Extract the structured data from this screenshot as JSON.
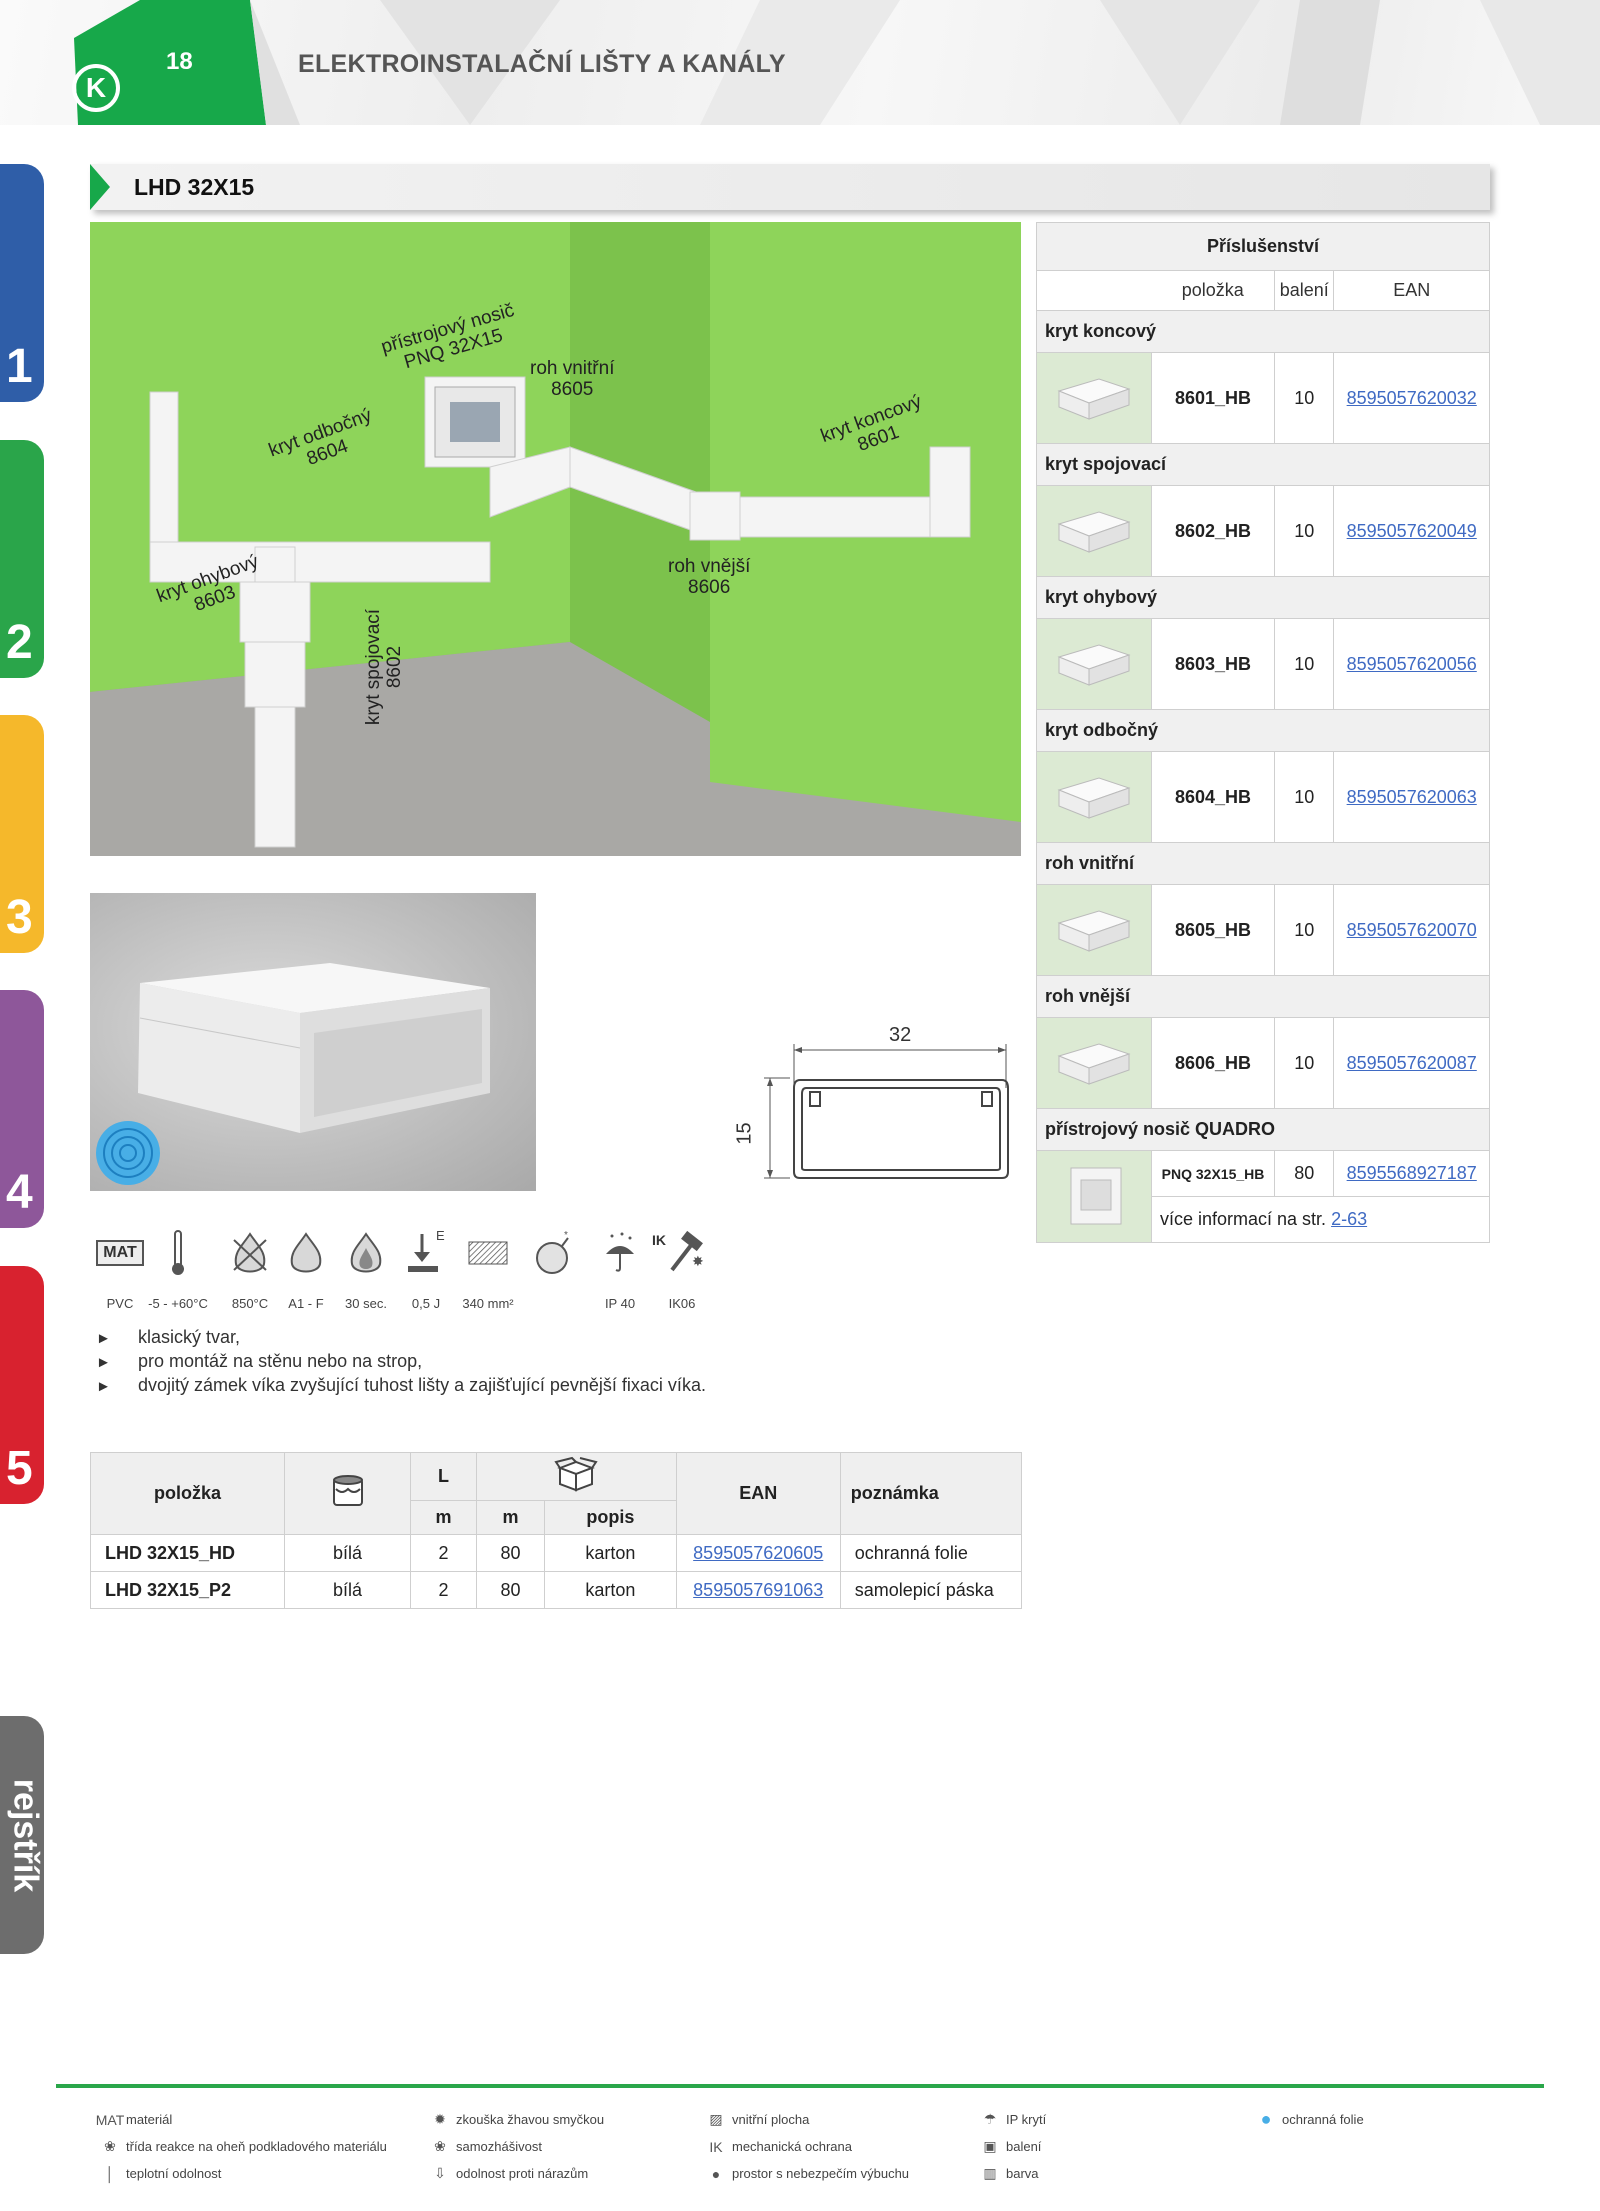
{
  "header": {
    "page_number": "18",
    "logo_letter": "K",
    "section_title": "ELEKTROINSTALAČNÍ LIŠTY A KANÁLY"
  },
  "side_tabs": [
    "1",
    "2",
    "3",
    "4",
    "5"
  ],
  "side_index_label": "rejstřík",
  "colors": {
    "green": "#17a84a",
    "tab_1": "#2f5ea8",
    "tab_2": "#2aa54a",
    "tab_3": "#f5b82b",
    "tab_4": "#8e579a",
    "tab_5": "#d8222f",
    "tab_index": "#6d6d6d",
    "link": "#3f6ac3",
    "wall": "#8fd45a"
  },
  "product_title": "LHD 32X15",
  "scene_labels": {
    "pnq_line1": "přístrojový nosič",
    "pnq_line2": "PNQ 32X15",
    "inner_corner_line1": "roh vnitřní",
    "inner_corner_line2": "8605",
    "end_cover_line1": "kryt koncový",
    "end_cover_line2": "8601",
    "branch_line1": "kryt odbočný",
    "branch_line2": "8604",
    "bend_line1": "kryt ohybový",
    "bend_line2": "8603",
    "outer_corner_line1": "roh vnější",
    "outer_corner_line2": "8606",
    "joint_line1": "kryt spojovací",
    "joint_line2": "8602"
  },
  "drawing": {
    "width_label": "32",
    "height_label": "15"
  },
  "accessories": {
    "caption": "Příslušenství",
    "col_item": "položka",
    "col_pack": "balení",
    "col_ean": "EAN",
    "groups": [
      {
        "name": "kryt koncový",
        "code": "8601_HB",
        "pack": "10",
        "ean": "8595057620032"
      },
      {
        "name": "kryt spojovací",
        "code": "8602_HB",
        "pack": "10",
        "ean": "8595057620049"
      },
      {
        "name": "kryt ohybový",
        "code": "8603_HB",
        "pack": "10",
        "ean": "8595057620056"
      },
      {
        "name": "kryt odbočný",
        "code": "8604_HB",
        "pack": "10",
        "ean": "8595057620063"
      },
      {
        "name": "roh vnitřní",
        "code": "8605_HB",
        "pack": "10",
        "ean": "8595057620070"
      },
      {
        "name": "roh vnější",
        "code": "8606_HB",
        "pack": "10",
        "ean": "8595057620087"
      }
    ],
    "quadro": {
      "name": "přístrojový nosič QUADRO",
      "code": "PNQ 32X15_HB",
      "pack": "80",
      "ean": "8595568927187",
      "more_text": "více informací na str.",
      "more_link": "2-63"
    }
  },
  "properties": [
    {
      "icon": "material-icon",
      "label": "PVC"
    },
    {
      "icon": "thermometer-icon",
      "label": "-5 - +60°C"
    },
    {
      "icon": "glow-wire-icon",
      "label": "850°C"
    },
    {
      "icon": "flame-icon",
      "label": "A1 - F"
    },
    {
      "icon": "self-extinguish-icon",
      "label": "30 sec."
    },
    {
      "icon": "impact-icon",
      "label": "0,5 J"
    },
    {
      "icon": "inner-area-icon",
      "label": "340 mm²"
    },
    {
      "icon": "explosion-icon",
      "label": ""
    },
    {
      "icon": "ip-icon",
      "label": "IP 40"
    },
    {
      "icon": "mechanical-protection-icon",
      "label": "IK06"
    }
  ],
  "icon_text": {
    "mat": "MAT",
    "impact_e": "E",
    "ik": "IK"
  },
  "bullets": [
    "klasický tvar,",
    "pro montáž na stěnu nebo na strop,",
    "dvojitý zámek víka zvyšující tuhost lišty a zajišťující pevnější fixaci víka."
  ],
  "product_table": {
    "h_item": "položka",
    "h_L": "L",
    "h_m1": "m",
    "h_m2": "m",
    "h_desc": "popis",
    "h_ean": "EAN",
    "h_note": "poznámka",
    "rows": [
      {
        "item": "LHD 32X15_HD",
        "color": "bílá",
        "L": "2",
        "qty": "80",
        "desc": "karton",
        "ean": "8595057620605",
        "note": "ochranná folie"
      },
      {
        "item": "LHD 32X15_P2",
        "color": "bílá",
        "L": "2",
        "qty": "80",
        "desc": "karton",
        "ean": "8595057691063",
        "note": "samolepicí páska"
      }
    ]
  },
  "legend": {
    "col1": [
      {
        "icon": "material-icon",
        "glyph": "MAT",
        "text": "materiál"
      },
      {
        "icon": "flame-icon",
        "glyph": "❀",
        "text": "třída reakce na oheň podkladového materiálu"
      },
      {
        "icon": "thermometer-icon",
        "glyph": "│",
        "text": "teplotní odolnost"
      }
    ],
    "col2": [
      {
        "icon": "glow-wire-icon",
        "glyph": "✹",
        "text": "zkouška žhavou smyčkou"
      },
      {
        "icon": "self-extinguish-icon",
        "glyph": "❀",
        "text": "samozhášivost"
      },
      {
        "icon": "impact-icon",
        "glyph": "⇩",
        "text": "odolnost proti nárazům"
      }
    ],
    "col3": [
      {
        "icon": "inner-area-icon",
        "glyph": "▨",
        "text": "vnitřní plocha"
      },
      {
        "icon": "mechanical-protection-icon",
        "glyph": "IK",
        "text": "mechanická ochrana"
      },
      {
        "icon": "explosion-icon",
        "glyph": "●",
        "text": "prostor s nebezpečím výbuchu"
      }
    ],
    "col4": [
      {
        "icon": "ip-icon",
        "glyph": "☂",
        "text": "IP krytí"
      },
      {
        "icon": "package-icon",
        "glyph": "▣",
        "text": "balení"
      },
      {
        "icon": "color-icon",
        "glyph": "▥",
        "text": "barva"
      }
    ],
    "col5": [
      {
        "icon": "protective-film-icon",
        "glyph": "●",
        "text": "ochranná folie"
      }
    ]
  }
}
